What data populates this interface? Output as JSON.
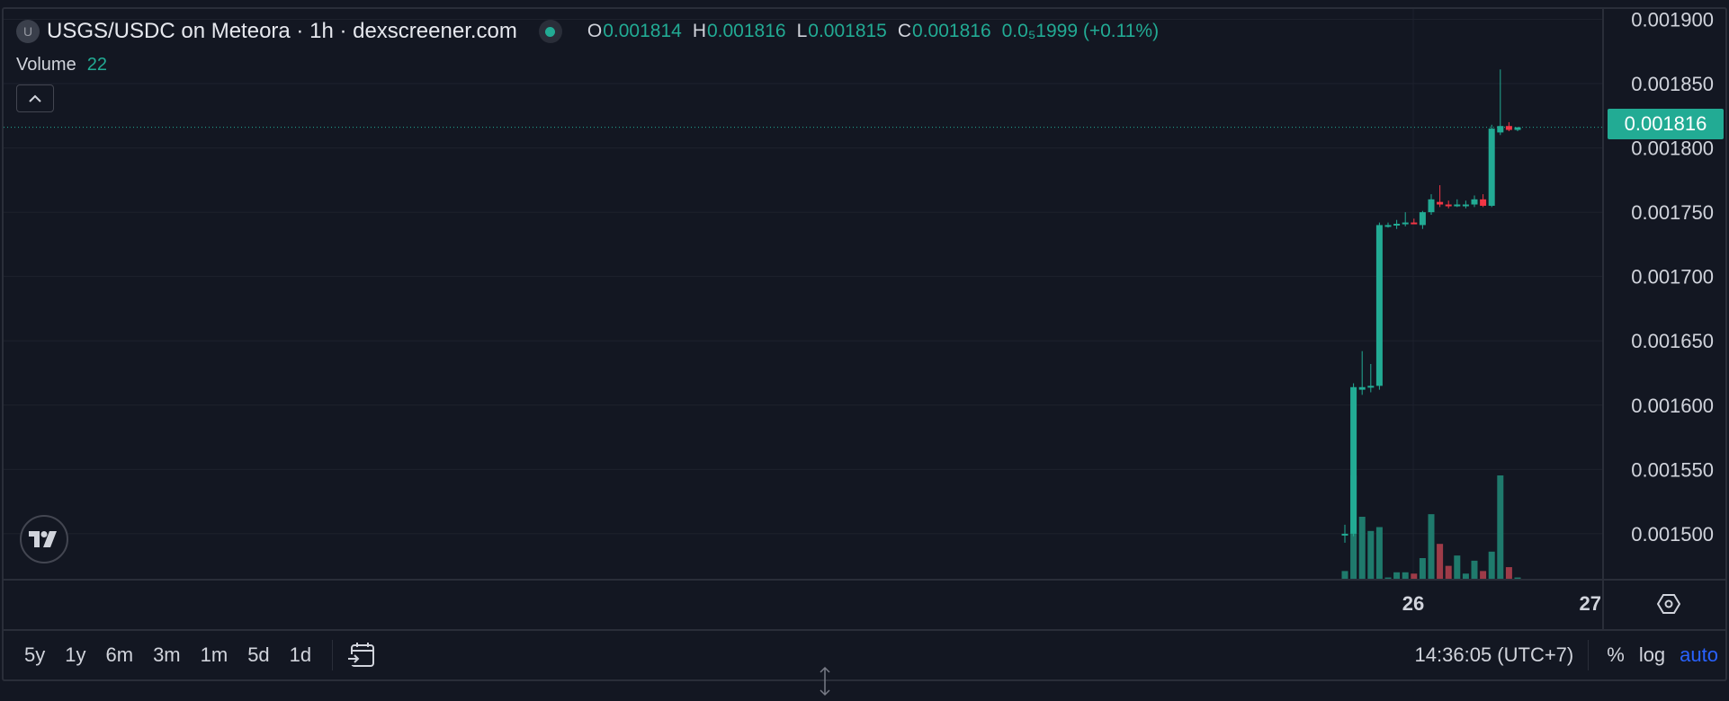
{
  "header": {
    "symbol_initial": "U",
    "title": "USGS/USDC on Meteora · 1h · dexscreener.com",
    "ohlc": {
      "o_label": "O",
      "o": "0.001814",
      "h_label": "H",
      "h": "0.001816",
      "l_label": "L",
      "l": "0.001815",
      "c_label": "C",
      "c": "0.001816",
      "change": "0.0₅1999 (+0.11%)"
    },
    "volume_label": "Volume",
    "volume_value": "22"
  },
  "price_axis": {
    "ticks": [
      "0.001900",
      "0.001850",
      "0.001800",
      "0.001750",
      "0.001700",
      "0.001650",
      "0.001600",
      "0.001550",
      "0.001500"
    ],
    "last_price_label": "0.001816"
  },
  "time_axis": {
    "ticks": [
      "26",
      "27"
    ]
  },
  "toolbar": {
    "ranges": [
      "5y",
      "1y",
      "6m",
      "3m",
      "1m",
      "5d",
      "1d"
    ],
    "clock": "14:36:05 (UTC+7)",
    "percent": "%",
    "log": "log",
    "auto": "auto"
  },
  "colors": {
    "background": "#131722",
    "up": "#22ab94",
    "down": "#f23645",
    "grid": "#1e222d",
    "text": "#d1d4dc",
    "accent_blue": "#2962ff"
  },
  "chart_data": {
    "type": "candlestick",
    "interval": "1h",
    "ylim": [
      0.001465,
      0.001908
    ],
    "ytick_values": [
      0.0019,
      0.00185,
      0.0018,
      0.00175,
      0.0017,
      0.00165,
      0.0016,
      0.00155,
      0.0015
    ],
    "last_price": 0.001816,
    "candles": [
      {
        "o": 0.0015,
        "h": 0.001507,
        "l": 0.001493,
        "c": 0.0015,
        "v": 6
      },
      {
        "o": 0.0015,
        "h": 0.001617,
        "l": 0.001498,
        "c": 0.001614,
        "v": 80
      },
      {
        "o": 0.001612,
        "h": 0.001642,
        "l": 0.001608,
        "c": 0.001614,
        "v": 48
      },
      {
        "o": 0.001614,
        "h": 0.001632,
        "l": 0.00161,
        "c": 0.001615,
        "v": 37
      },
      {
        "o": 0.001615,
        "h": 0.001742,
        "l": 0.001612,
        "c": 0.00174,
        "v": 40
      },
      {
        "o": 0.00174,
        "h": 0.001742,
        "l": 0.001738,
        "c": 0.00174,
        "v": 1
      },
      {
        "o": 0.00174,
        "h": 0.001744,
        "l": 0.001737,
        "c": 0.001741,
        "v": 5
      },
      {
        "o": 0.001741,
        "h": 0.00175,
        "l": 0.001739,
        "c": 0.001742,
        "v": 5
      },
      {
        "o": 0.001742,
        "h": 0.001745,
        "l": 0.001741,
        "c": 0.001741,
        "v": 4
      },
      {
        "o": 0.00174,
        "h": 0.001751,
        "l": 0.001737,
        "c": 0.00175,
        "v": 16
      },
      {
        "o": 0.00175,
        "h": 0.001764,
        "l": 0.001748,
        "c": 0.00176,
        "v": 50
      },
      {
        "o": 0.001758,
        "h": 0.001771,
        "l": 0.001754,
        "c": 0.001756,
        "v": 27
      },
      {
        "o": 0.001756,
        "h": 0.001759,
        "l": 0.001753,
        "c": 0.001755,
        "v": 10
      },
      {
        "o": 0.001755,
        "h": 0.00176,
        "l": 0.001754,
        "c": 0.001756,
        "v": 18
      },
      {
        "o": 0.001755,
        "h": 0.001759,
        "l": 0.001753,
        "c": 0.001756,
        "v": 4
      },
      {
        "o": 0.001756,
        "h": 0.001763,
        "l": 0.001754,
        "c": 0.00176,
        "v": 14
      },
      {
        "o": 0.00176,
        "h": 0.001764,
        "l": 0.001754,
        "c": 0.001755,
        "v": 6
      },
      {
        "o": 0.001755,
        "h": 0.001818,
        "l": 0.001754,
        "c": 0.001815,
        "v": 21
      },
      {
        "o": 0.001812,
        "h": 0.001861,
        "l": 0.00181,
        "c": 0.001817,
        "v": 80
      },
      {
        "o": 0.001817,
        "h": 0.00182,
        "l": 0.001813,
        "c": 0.001814,
        "v": 9
      },
      {
        "o": 0.001814,
        "h": 0.001816,
        "l": 0.001813,
        "c": 0.001816,
        "v": 1
      }
    ]
  }
}
